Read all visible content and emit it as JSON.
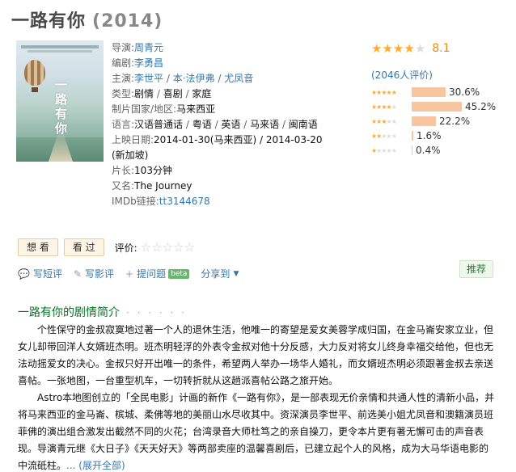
{
  "movie": {
    "title": "一路有你",
    "year": "(2014)",
    "poster_title": "一路有你"
  },
  "info": [
    {
      "key": "director",
      "label": "导演:",
      "values": [
        "周青元"
      ],
      "linked": true
    },
    {
      "key": "writer",
      "label": "编剧:",
      "values": [
        "李勇昌"
      ],
      "linked": true
    },
    {
      "key": "cast",
      "label": "主演:",
      "values": [
        "李世平",
        "本·法伊弗",
        "尤凤音"
      ],
      "linked": true
    },
    {
      "key": "genre",
      "label": "类型:",
      "values": [
        "剧情",
        "喜剧",
        "家庭"
      ],
      "linked": false
    },
    {
      "key": "country",
      "label": "制片国家/地区:",
      "values": [
        "马来西亚"
      ],
      "linked": false
    },
    {
      "key": "language",
      "label": "语言:",
      "values": [
        "汉语普通话",
        "粤语",
        "英语",
        "马来语",
        "闽南语"
      ],
      "linked": false
    }
  ],
  "release": {
    "label": "上映日期:",
    "line1": "2014-01-30(马来西亚) / 2014-03-20",
    "line2": "(新加坡)"
  },
  "runtime": {
    "label": "片长:",
    "value": "103分钟"
  },
  "aka": {
    "label": "又名:",
    "value": "The Journey"
  },
  "imdb": {
    "label": "IMDb链接:",
    "value": "tt3144678"
  },
  "rating": {
    "stars": 4,
    "max_stars": 5,
    "score": "8.1",
    "votes": "(2046人评价)",
    "distribution": [
      {
        "stars": 5,
        "percent": "30.6%",
        "fraction": 0.306
      },
      {
        "stars": 4,
        "percent": "45.2%",
        "fraction": 0.452
      },
      {
        "stars": 3,
        "percent": "22.2%",
        "fraction": 0.222
      },
      {
        "stars": 2,
        "percent": "1.6%",
        "fraction": 0.016
      },
      {
        "stars": 1,
        "percent": "0.4%",
        "fraction": 0.004
      }
    ],
    "star_color": "#ffac2d",
    "bar_color": "#f7c5a0"
  },
  "buttons": {
    "want": "想 看",
    "seen": "看 过",
    "rate_label": "评价:"
  },
  "actions": {
    "short_review": "写短评",
    "review": "写影评",
    "question": "提问题",
    "beta": "beta",
    "share": "分享到",
    "recommend": "推荐"
  },
  "synopsis": {
    "title": "一路有你的剧情简介",
    "dots": "· · · · · ·",
    "p1": "个性保守的金叔寂寞地过著一个人的退休生活，他唯一的寄望是爱女美蓉学成归国，在金马崙安家立业，但女儿却带回洋人女婿班杰明。班杰明轻浮的外表令金叔对他十分反感，大力反对将女儿终身幸福交给他，但也无法动摇爱女的决心。金叔只好开出唯一的条件，希望两人举办一场华人婚礼，而女婿班杰明必须跟著金叔去亲送喜帖。一张地图，一台重型机车，一切转折就从这趟派喜帖公路之旅开始。",
    "p2": "Astro本地图创立的「全民电影」计画的新作《一路有你》，是一部表现无价亲情和共通人性的清新小品，并将马来西亚的金马崙、槟城、柔佛等地的美丽山水尽收其中。资深演员李世平、前选美小姐尤凤音和澳籍演员班菲佛的演出组合激发出截然不同的火花；台湾录音大师杜笃之的亲自操刀，更令本片更有著无懈可击的声音表现。导演青元继《大日子》《天天好天》等两部卖座的温馨喜剧后，已建立起个人的风格，成为大马华语电影的中流砥柱。",
    "more": "... (展开全部)"
  }
}
